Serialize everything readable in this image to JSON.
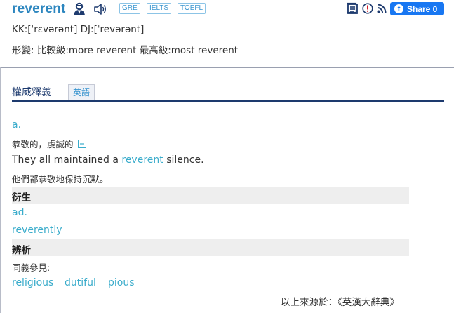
{
  "entry": {
    "headword": "reverent",
    "exam_tags": [
      "GRE",
      "IELTS",
      "TOEFL"
    ],
    "pronunciation": "KK:[ˈrɛvərənt] DJ:[ˈrevərənt]",
    "inflection": "形變: 比較級:more reverent  最高級:most reverent"
  },
  "toolbar": {
    "share_label": "Share 0",
    "icons": [
      "person-icon",
      "speaker-icon",
      "add-to-list-icon",
      "report-icon",
      "rss-icon",
      "facebook-icon"
    ]
  },
  "section": {
    "title": "權威釋義",
    "tab_label": "英語"
  },
  "definition": {
    "pos": "a.",
    "meaning": "恭敬的，虔誠的",
    "example_before": "They all maintained a ",
    "example_keyword": "reverent",
    "example_after": " silence.",
    "example_translation": "他們都恭敬地保持沉默。"
  },
  "derivation": {
    "label": "衍生",
    "pos": "ad.",
    "word": "reverently"
  },
  "analysis": {
    "label": "辨析",
    "see_also_label": "同義參見:",
    "synonyms": [
      "religious",
      "dutiful",
      "pious"
    ]
  },
  "source": "以上來源於：《英漢大辭典》",
  "colors": {
    "headword": "#2c86bf",
    "link": "#3aaccb",
    "navy_rule": "#1d3a6e",
    "band": "#eeeeee",
    "facebook": "#1877f2"
  }
}
